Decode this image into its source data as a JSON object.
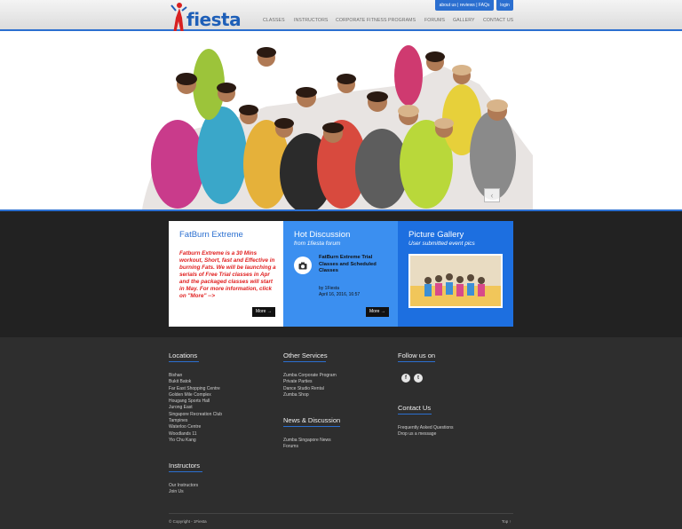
{
  "header": {
    "logo_text": "fiesta",
    "util_links": "about us | reviews | FAQs",
    "login": "login",
    "nav": [
      "CLASSES",
      "INSTRUCTORS",
      "CORPORATE FITNESS PROGRAMS",
      "FORUMS",
      "GALLERY",
      "CONTACT US"
    ]
  },
  "hero": {
    "prev": "‹",
    "next": "›"
  },
  "boxes": {
    "fatburn": {
      "title": "FatBurn Extreme",
      "text": "Fatburn Extreme is a 30 Mins workout, Short, fast and Effective in burning Fats. We will be launching a serials of Free Trial classes in Apr and the packaged classes will start in May. For more information, click on \"More\"  -->",
      "more": "More →"
    },
    "discussion": {
      "title": "Hot Discussion",
      "subtitle": "from 1fiesta forum",
      "post_title": "FatBurn Extreme Trial Classes and Scheduled Classes",
      "post_by": "by  1Fiesta",
      "post_date": "April 16, 2016, 16:57",
      "more": "More →"
    },
    "gallery": {
      "title": "Picture Gallery",
      "subtitle": "User submitted event pics"
    }
  },
  "footer": {
    "locations_title": "Locations",
    "locations": [
      "Bishan",
      "Bukit Batok",
      "Far East Shopping Centre",
      "Golden Mile Complex",
      "Hougang Sports Hall",
      "Jurong East",
      "Singapore Recreation Club",
      "Tampines",
      "Waterloo Centre",
      "Woodlands 11",
      "Yio Chu Kang"
    ],
    "instructors_title": "Instructors",
    "instructors": [
      "Our Instructors",
      "Join Us"
    ],
    "services_title": "Other Services",
    "services": [
      "Zumba Corporate Program",
      "Private Parties",
      "Dance Studio Rental",
      "Zumba Shop"
    ],
    "news_title": "News & Discussion",
    "news": [
      "Zumba Singapore News",
      "Forums"
    ],
    "follow_title": "Follow us on",
    "social": [
      "f",
      "t"
    ],
    "contact_title": "Contact Us",
    "contact": [
      "Frequently Asked Questions",
      "Drop us a message"
    ],
    "copyright": "© Copyright - 1Fiesta",
    "top": "Top  ↑"
  },
  "colors": {
    "accent": "#2b6fd0",
    "box_blue_light": "#3b8ff0",
    "box_blue": "#1d6fe0",
    "promo_red": "#e01e1e"
  }
}
